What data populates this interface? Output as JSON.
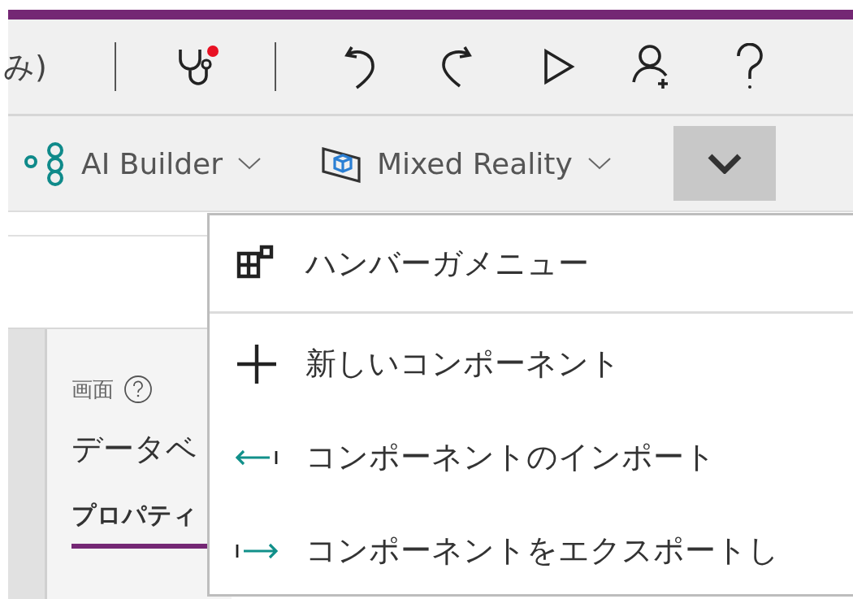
{
  "title_bar": {
    "text": "み)"
  },
  "app_checker": {
    "alert": true
  },
  "ribbon": {
    "items": [
      {
        "kind": "ai",
        "label": "AI Builder"
      },
      {
        "kind": "mr",
        "label": "Mixed Reality"
      }
    ],
    "more": {
      "expanded": true
    }
  },
  "panel": {
    "label": "画面",
    "title": "データベ",
    "tabs": [
      {
        "label": "プロパティ",
        "selected": true
      }
    ]
  },
  "menu": {
    "sections": [
      [
        {
          "kind": "grid",
          "label": "ハンバーガメニュー"
        }
      ],
      [
        {
          "kind": "plus",
          "label": "新しいコンポーネント"
        },
        {
          "kind": "import",
          "label": "コンポーネントのインポート"
        },
        {
          "kind": "export",
          "label": "コンポーネントをエクスポートし"
        }
      ]
    ]
  }
}
